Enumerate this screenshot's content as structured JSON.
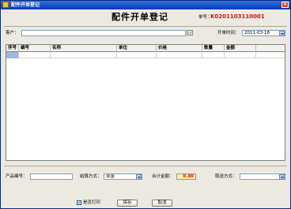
{
  "window": {
    "title": "配件开单登记",
    "close_symbol": "×"
  },
  "header": {
    "title": "配件开单登记",
    "doc_no_label": "单号：",
    "doc_no_value": "K0201103110001"
  },
  "customer": {
    "label": "客户：",
    "value": "",
    "browse_label": "..."
  },
  "open_time": {
    "label": "开单时间：",
    "value": "2011-03-18"
  },
  "table": {
    "columns": [
      "序号",
      "编号",
      "名称",
      "单位",
      "价格",
      "数量",
      "金额"
    ],
    "rows": [
      [
        "",
        "",
        "",
        "",
        "",
        "",
        ""
      ]
    ]
  },
  "footer": {
    "product_code_label": "产品编号：",
    "product_code_value": "",
    "settle_label": "结算方式：",
    "settle_value": "现金",
    "total_label": "合计金额：",
    "total_value": "0.00",
    "delivery_label": "取送方式：",
    "delivery_value": ""
  },
  "actions": {
    "print_label": "是否打印",
    "print_checked": true,
    "save_label": "保存",
    "cancel_label": "取消"
  },
  "colors": {
    "total_highlight": "#ffef9a",
    "total_text": "#d01010",
    "doc_no_text": "#d01010",
    "selection": "#9fb7e6"
  }
}
